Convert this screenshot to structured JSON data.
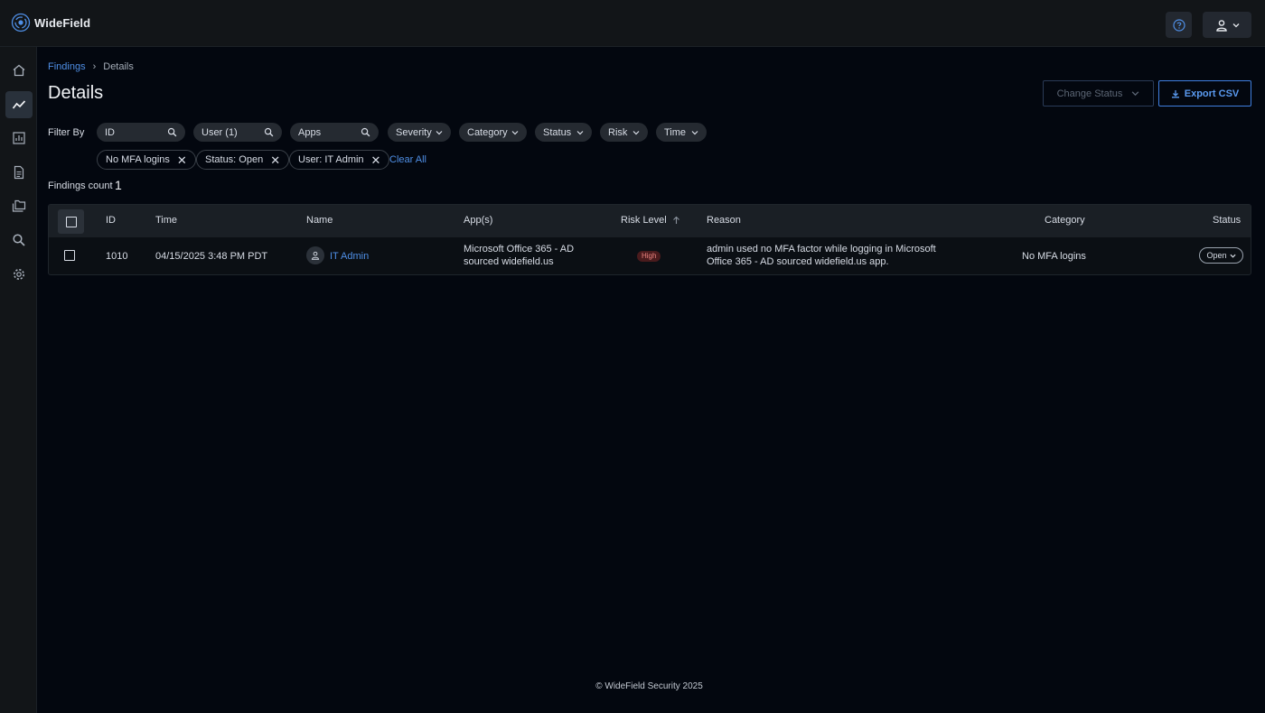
{
  "app": {
    "name": "WideField",
    "accent": "#4f8fe6"
  },
  "header": {
    "help_icon": "help-circle-icon",
    "user_icon": "user-icon"
  },
  "sidebar": {
    "items": [
      {
        "name": "home",
        "icon": "home-icon",
        "active": false
      },
      {
        "name": "findings",
        "icon": "trend-icon",
        "active": true
      },
      {
        "name": "reports",
        "icon": "bar-chart-icon",
        "active": false
      },
      {
        "name": "documents",
        "icon": "document-icon",
        "active": false
      },
      {
        "name": "folders",
        "icon": "folder-icon",
        "active": false
      },
      {
        "name": "search",
        "icon": "search-icon",
        "active": false
      },
      {
        "name": "settings",
        "icon": "gear-icon",
        "active": false
      }
    ]
  },
  "breadcrumb": {
    "root": "Findings",
    "separator": "›",
    "current": "Details"
  },
  "page": {
    "title": "Details",
    "change_status_label": "Change Status",
    "export_csv_label": "Export CSV"
  },
  "filters": {
    "label": "Filter By",
    "search_fields": [
      {
        "label": "ID"
      },
      {
        "label": "User (1)"
      },
      {
        "label": "Apps"
      }
    ],
    "dropdowns": [
      {
        "label": "Severity"
      },
      {
        "label": "Category"
      },
      {
        "label": "Status"
      },
      {
        "label": "Risk"
      },
      {
        "label": "Time"
      }
    ],
    "active_chips": [
      {
        "label": "No MFA logins"
      },
      {
        "label": "Status: Open"
      },
      {
        "label": "User: IT Admin"
      }
    ],
    "clear_all_label": "Clear All"
  },
  "summary": {
    "count_label": "Findings count",
    "count_value": "1"
  },
  "table": {
    "columns": {
      "id": "ID",
      "time": "Time",
      "name": "Name",
      "apps": "App(s)",
      "risk": "Risk Level",
      "reason": "Reason",
      "category": "Category",
      "status": "Status"
    },
    "sort_column": "risk",
    "rows": [
      {
        "id": "1010",
        "time": "04/15/2025 3:48 PM PDT",
        "name": "IT Admin",
        "apps_line1": "Microsoft Office 365 - AD",
        "apps_line2": "sourced widefield.us",
        "risk": "High",
        "risk_color": "#e9837f",
        "reason_line1": "admin used no MFA factor while logging in Microsoft",
        "reason_line2": "Office 365 - AD sourced widefield.us app.",
        "category": "No MFA logins",
        "status": "Open"
      }
    ]
  },
  "footer": {
    "text": "© WideField Security 2025"
  }
}
